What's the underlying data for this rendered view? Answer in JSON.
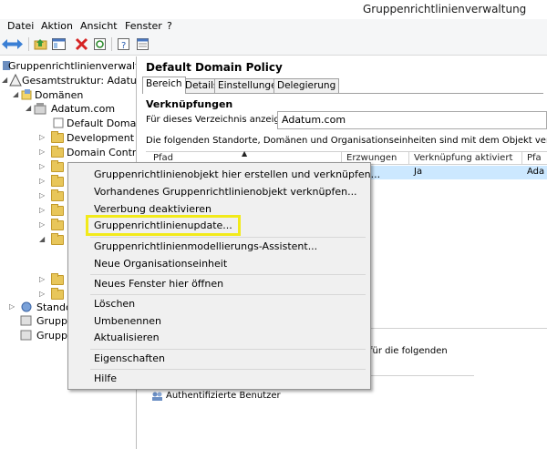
{
  "window": {
    "title": "Gruppenrichtlinienverwaltung"
  },
  "menu": [
    "Datei",
    "Aktion",
    "Ansicht",
    "Fenster",
    "?"
  ],
  "tree": {
    "root": "Gruppenrichtlinienverwaltung",
    "forest": "Gesamtstruktur: Adatum.c",
    "domains": "Domänen",
    "domain": "Adatum.com",
    "children": [
      "Default Domain",
      "Development",
      "Domain Contro"
    ],
    "sites": "Stando",
    "gpo1": "Gruppe",
    "gpo2": "Gruppe"
  },
  "details": {
    "title": "Default Domain Policy",
    "tabs": [
      "Bereich",
      "Details",
      "Einstellungen",
      "Delegierung"
    ],
    "links_title": "Verknüpfungen",
    "show_label": "Für dieses Verzeichnis anzeigen:",
    "location_value": "Adatum.com",
    "description": "Die folgenden Standorte, Domänen und Organisationseinheiten sind mit dem Objekt verknüpft:",
    "columns": [
      "Pfad",
      "Erzwungen",
      "Verknüpfung aktiviert",
      "Pfa"
    ],
    "row": {
      "enforced_value": "Ja",
      "path_value": "Ada"
    },
    "filter_text": "für die folgenden",
    "auth_user": "Authentifizierte Benutzer"
  },
  "context_menu": {
    "items": [
      "Gruppenrichtlinienobjekt hier erstellen und verknüpfen...",
      "Vorhandenes Gruppenrichtlinienobjekt verknüpfen...",
      "Vererbung deaktivieren",
      "Gruppenrichtlinienupdate...",
      "Gruppenrichtlinienmodellierungs-Assistent...",
      "Neue Organisationseinheit",
      "Neues Fenster hier öffnen",
      "Löschen",
      "Umbenennen",
      "Aktualisieren",
      "Eigenschaften",
      "Hilfe"
    ],
    "highlight_color": "#f2ea1a"
  }
}
